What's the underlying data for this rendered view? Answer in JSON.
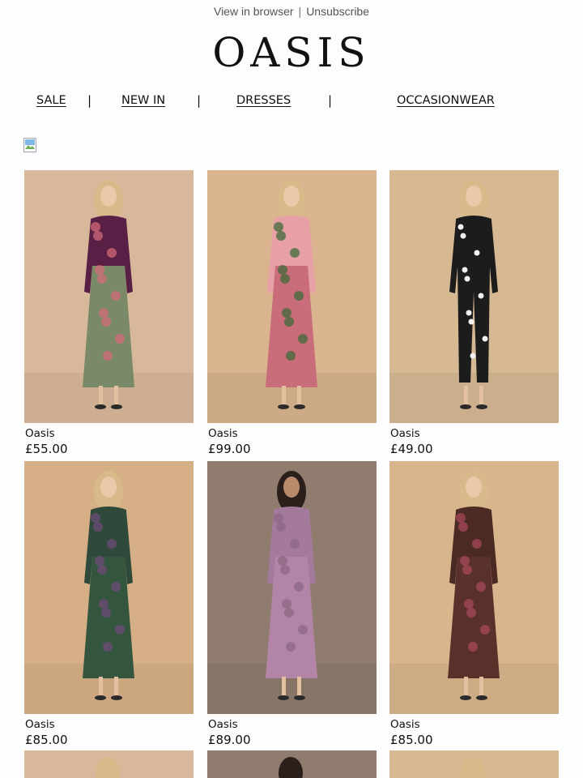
{
  "header": {
    "view_in_browser": "View in browser",
    "separator": "|",
    "unsubscribe": "Unsubscribe"
  },
  "logo": {
    "text": "OASIS"
  },
  "nav": {
    "items": [
      {
        "label": "SALE"
      },
      {
        "label": "NEW IN"
      },
      {
        "label": "DRESSES"
      },
      {
        "label": "OCCASIONWEAR"
      }
    ],
    "separator": "|"
  },
  "products": [
    {
      "brand": "Oasis",
      "price": "£55.00",
      "bg": "#d8b89a",
      "top": "#5a1f44",
      "bottom": "#7a8a68",
      "accent": "#d46b7a"
    },
    {
      "brand": "Oasis",
      "price": "£99.00",
      "bg": "#d9b48e",
      "top": "#e6a0a6",
      "bottom": "#c96d7a",
      "accent": "#3f6b3a"
    },
    {
      "brand": "Oasis",
      "price": "£49.00",
      "bg": "#d6b893",
      "top": "#1c1c1c",
      "bottom": "#1c1c1c",
      "accent": "#f2f2f2"
    },
    {
      "brand": "Oasis",
      "price": "£85.00",
      "bg": "#d7af86",
      "top": "#2f4a3a",
      "bottom": "#34563f",
      "accent": "#6d4b7a"
    },
    {
      "brand": "Oasis",
      "price": "£89.00",
      "bg": "#8f7c6e",
      "top": "#a37a9b",
      "bottom": "#b285a8",
      "accent": "#8c6884"
    },
    {
      "brand": "Oasis",
      "price": "£85.00",
      "bg": "#d8b58c",
      "top": "#4a2a22",
      "bottom": "#5a302a",
      "accent": "#a8485a"
    }
  ],
  "partial_row": [
    {
      "bg": "#d8b89a"
    },
    {
      "bg": "#8f7c6e"
    },
    {
      "bg": "#d6b893"
    }
  ]
}
